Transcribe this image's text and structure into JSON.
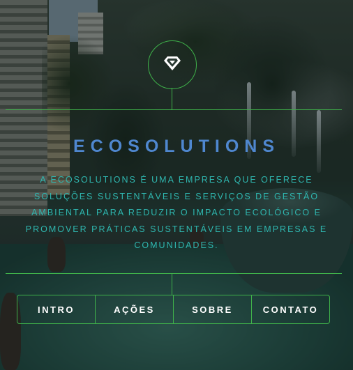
{
  "header": {
    "logo_icon": "diamond-icon",
    "title": "ECOSOLUTIONS",
    "description": "A ECOSOLUTIONS É UMA EMPRESA QUE OFERECE SOLUÇÕES SUSTENTÁVEIS E SERVIÇOS DE GESTÃO AMBIENTAL PARA REDUZIR O IMPACTO ECOLÓGICO E PROMOVER PRÁTICAS SUSTENTÁVEIS EM EMPRESAS E COMUNIDADES."
  },
  "nav": {
    "items": [
      {
        "label": "INTRO"
      },
      {
        "label": "AÇÕES"
      },
      {
        "label": "SOBRE"
      },
      {
        "label": "CONTATO"
      }
    ]
  },
  "colors": {
    "line": "#3fb24a",
    "title": "#4f87cf",
    "description": "#2fb7b0",
    "nav_text": "#ffffff"
  }
}
